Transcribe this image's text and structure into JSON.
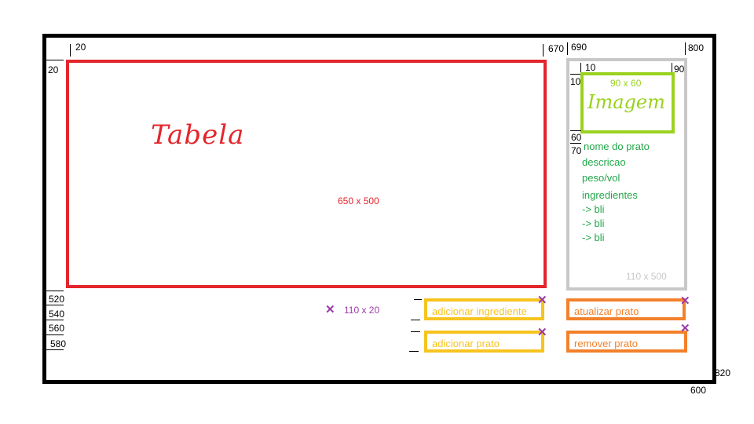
{
  "table": {
    "title": "Tabela",
    "size": "650 x 500"
  },
  "detail": {
    "image_size": "90 x 60",
    "image_label": "Imagem",
    "name": "nome do prato",
    "description": "descricao",
    "weight": "peso/vol",
    "ingredients": "ingredientes",
    "items": [
      "-> bli",
      "-> bli",
      "-> bli"
    ],
    "size": "110 x 500"
  },
  "buttons": {
    "add_ingredient": "adicionar ingrediente",
    "add_dish": "adicionar prato",
    "update_dish": "atualizar prato",
    "remove_dish": "remover prato",
    "size": "110 x 20"
  },
  "dimensions": {
    "top_left_x": "20",
    "table_right": "670",
    "panel_left": "690",
    "panel_right": "800",
    "top_left_y": "20",
    "img_x": "10",
    "img_right": "90",
    "img_y": "10",
    "img_bottom": "60",
    "text_top": "70",
    "row1": "520",
    "row2": "540",
    "row3": "560",
    "row4": "580",
    "total_width": "820",
    "total_height": "600"
  },
  "colors": {
    "table": "#e3262c",
    "panel": "#c8c8c8",
    "image": "#9ad21f",
    "text": "#22a84a",
    "button_yellow": "#f7c41f",
    "button_orange": "#f3802b",
    "marker": "#9b3aa8"
  }
}
